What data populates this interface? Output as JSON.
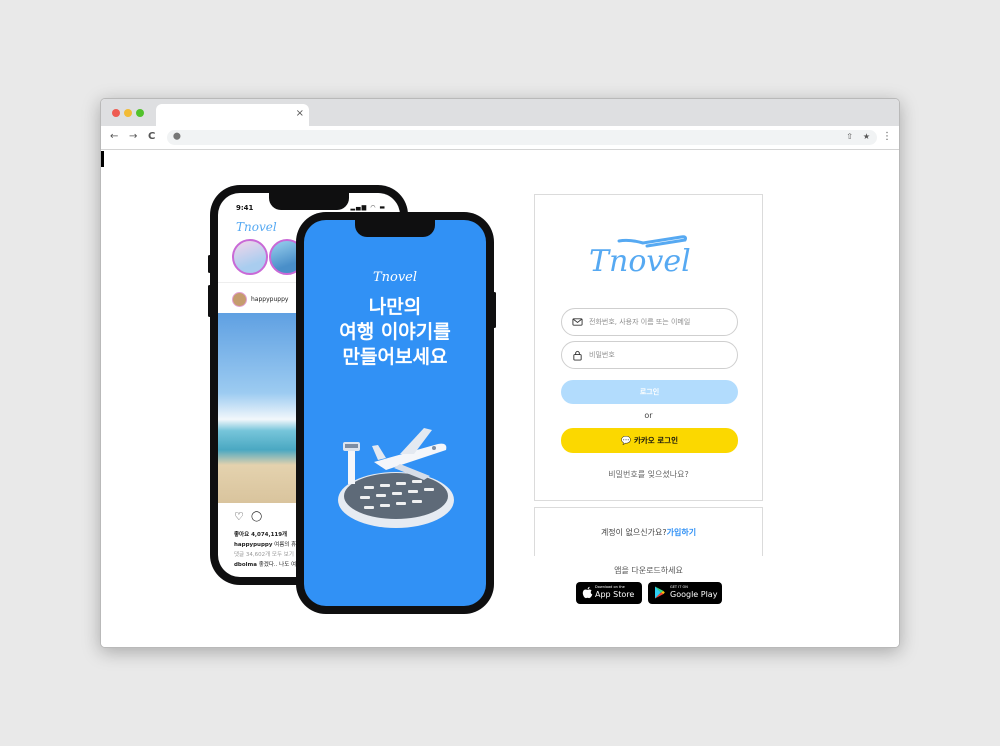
{
  "browser": {
    "tab_close": "×",
    "nav": {
      "back": "←",
      "forward": "→",
      "reload": "C"
    },
    "address_value": "",
    "lock": "⬤",
    "share": "⇧",
    "star": "★",
    "menu": "⋮"
  },
  "phone_back": {
    "time": "9:41",
    "status_icons": "▂▄▆ ◠ ▬",
    "app_logo": "Tnovel",
    "post_user": "happypuppy",
    "likes": "좋아요 4,074,119개",
    "caption_user": "happypuppy",
    "caption_text": "여름의 휴",
    "comments": "댓글 34,602개 모두 보기",
    "comment_user": "dbolma",
    "comment_text": "좋겠다.. 나도 여"
  },
  "phone_front": {
    "app_logo": "Tnovel",
    "headline_lines": [
      "나만의",
      "여행 이야기를",
      "만들어보세요"
    ]
  },
  "login": {
    "brand_logo": "Tnovel",
    "id_placeholder": "전화번호, 사용자 이름 또는 이메일",
    "password_placeholder": "비밀번호",
    "login_button": "로그인",
    "or": "or",
    "kakao_icon": "💬",
    "kakao_button": "카카오 로그인",
    "forgot_password": "비밀번호를 잊으셨나요?"
  },
  "signup": {
    "prompt": "계정이 없으신가요?",
    "link": "가입하기"
  },
  "download": {
    "text": "앱을 다운로드하세요",
    "app_store_small": "Download on the",
    "app_store": "App Store",
    "google_play_small": "GET IT ON",
    "google_play": "Google Play"
  },
  "colors": {
    "brand_blue": "#3191f5",
    "login_button_disabled": "#b2dcfd",
    "kakao_yellow": "#fbd800",
    "logo_blue": "#56a9f2"
  }
}
